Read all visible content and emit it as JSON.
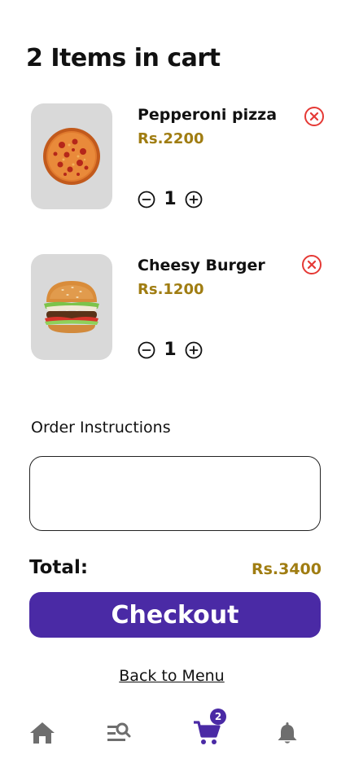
{
  "cart": {
    "title": "2 Items in cart",
    "items": [
      {
        "name": "Pepperoni pizza",
        "price": "Rs.2200",
        "quantity": "1",
        "image": "pepperoni-pizza"
      },
      {
        "name": "Cheesy Burger",
        "price": "Rs.1200",
        "quantity": "1",
        "image": "cheesy-burger"
      }
    ]
  },
  "instructions": {
    "label": "Order Instructions",
    "value": ""
  },
  "summary": {
    "total_label": "Total:",
    "total_value": "Rs.3400"
  },
  "checkout": {
    "label": "Checkout"
  },
  "back_link": {
    "label": "Back to Menu"
  },
  "nav": {
    "items": [
      {
        "icon": "home-icon",
        "active": false
      },
      {
        "icon": "menu-search-icon",
        "active": false
      },
      {
        "icon": "cart-icon",
        "active": true,
        "badge": "2"
      },
      {
        "icon": "bell-icon",
        "active": false
      }
    ]
  },
  "colors": {
    "accent": "#4a2aa5",
    "price": "#a07d12",
    "remove": "#e53935",
    "nav_inactive": "#6e6e6e",
    "thumb_bg": "#d9d9d9"
  }
}
